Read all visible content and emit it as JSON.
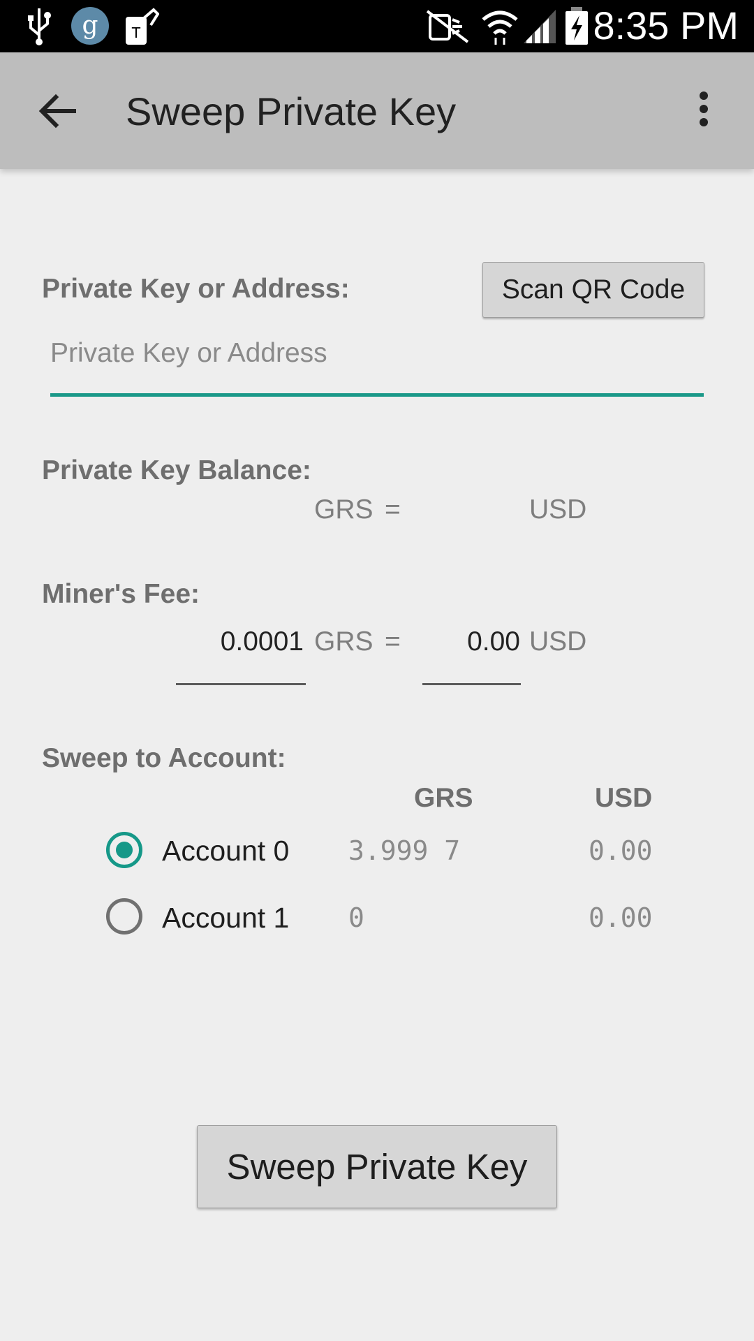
{
  "status_bar": {
    "time": "8:35 PM",
    "icons": [
      "usb-icon",
      "g-app-icon",
      "tag-app-icon",
      "mute-icon",
      "wifi-icon",
      "signal-icon",
      "battery-charging-icon"
    ]
  },
  "toolbar": {
    "title": "Sweep Private Key",
    "back_icon": "arrow-left-icon",
    "menu_icon": "more-vert-icon"
  },
  "private_key": {
    "label": "Private Key or Address:",
    "scan_button": "Scan QR Code",
    "placeholder": "Private Key or Address",
    "value": ""
  },
  "balance": {
    "label": "Private Key Balance:",
    "grs_unit": "GRS",
    "equals": "=",
    "usd_unit": "USD"
  },
  "fee": {
    "label": "Miner's Fee:",
    "grs_value": "0.0001",
    "grs_unit": "GRS",
    "equals": "=",
    "usd_value": "0.00",
    "usd_unit": "USD"
  },
  "accounts": {
    "label": "Sweep to Account:",
    "col_grs": "GRS",
    "col_usd": "USD",
    "items": [
      {
        "name": "Account 0",
        "grs": "3.999 7",
        "usd": "0.00",
        "selected": true
      },
      {
        "name": "Account 1",
        "grs": "0",
        "usd": "0.00",
        "selected": false
      }
    ]
  },
  "sweep_button": "Sweep Private Key",
  "colors": {
    "accent": "#159888",
    "toolbar_bg": "#bdbdbd",
    "page_bg": "#eeeeee",
    "button_bg": "#d6d6d6"
  }
}
